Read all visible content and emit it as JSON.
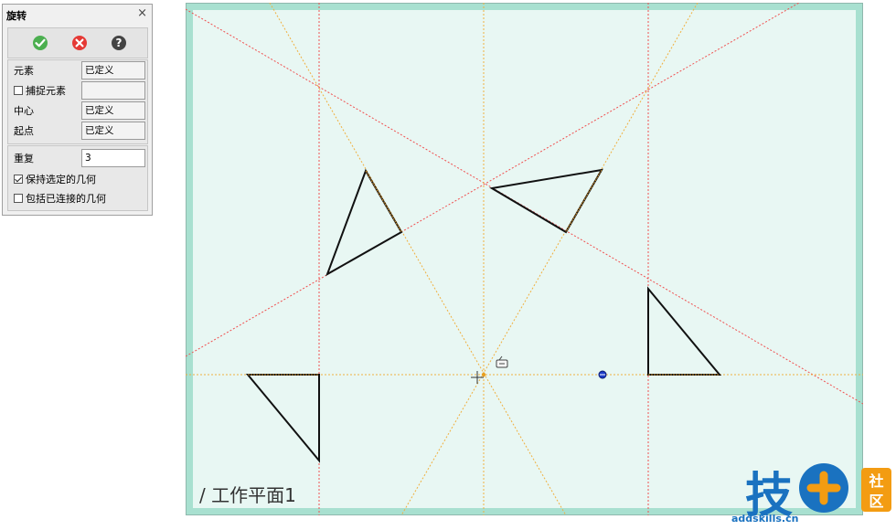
{
  "panel": {
    "title": "旋转",
    "close_glyph": "×",
    "buttons": [
      {
        "name": "ok",
        "icon": "check-icon",
        "color": "#4caf50"
      },
      {
        "name": "cancel",
        "icon": "cancel-icon",
        "color": "#e53935"
      },
      {
        "name": "help",
        "icon": "help-icon",
        "color": "#444444",
        "glyph": "?"
      }
    ],
    "fields": {
      "element_label": "元素",
      "element_value": "已定义",
      "snap_label": "捕捉元素",
      "snap_value": "",
      "center_label": "中心",
      "center_value": "已定义",
      "start_label": "起点",
      "start_value": "已定义"
    },
    "options": {
      "repeat_label": "重复",
      "repeat_value": "3",
      "keep_selected_label": "保持选定的几何",
      "keep_selected_checked": true,
      "include_connected_label": "包括已连接的几何",
      "include_connected_checked": false
    }
  },
  "canvas": {
    "workplane_label": "/ 工作平面1",
    "colors": {
      "background": "#e8f7f3",
      "frame": "#a8e0d0",
      "border": "#8fb8ad",
      "red_guides": "#f05050",
      "orange_guides": "#f0b040",
      "shape_stroke": "#111111",
      "point": "#1e3cc8"
    }
  },
  "watermark": {
    "brand": "技",
    "tag_top": "社",
    "tag_bottom": "区",
    "site": "addskills.cn",
    "colors": {
      "blue": "#1a72c0",
      "orange": "#f39c12"
    }
  }
}
